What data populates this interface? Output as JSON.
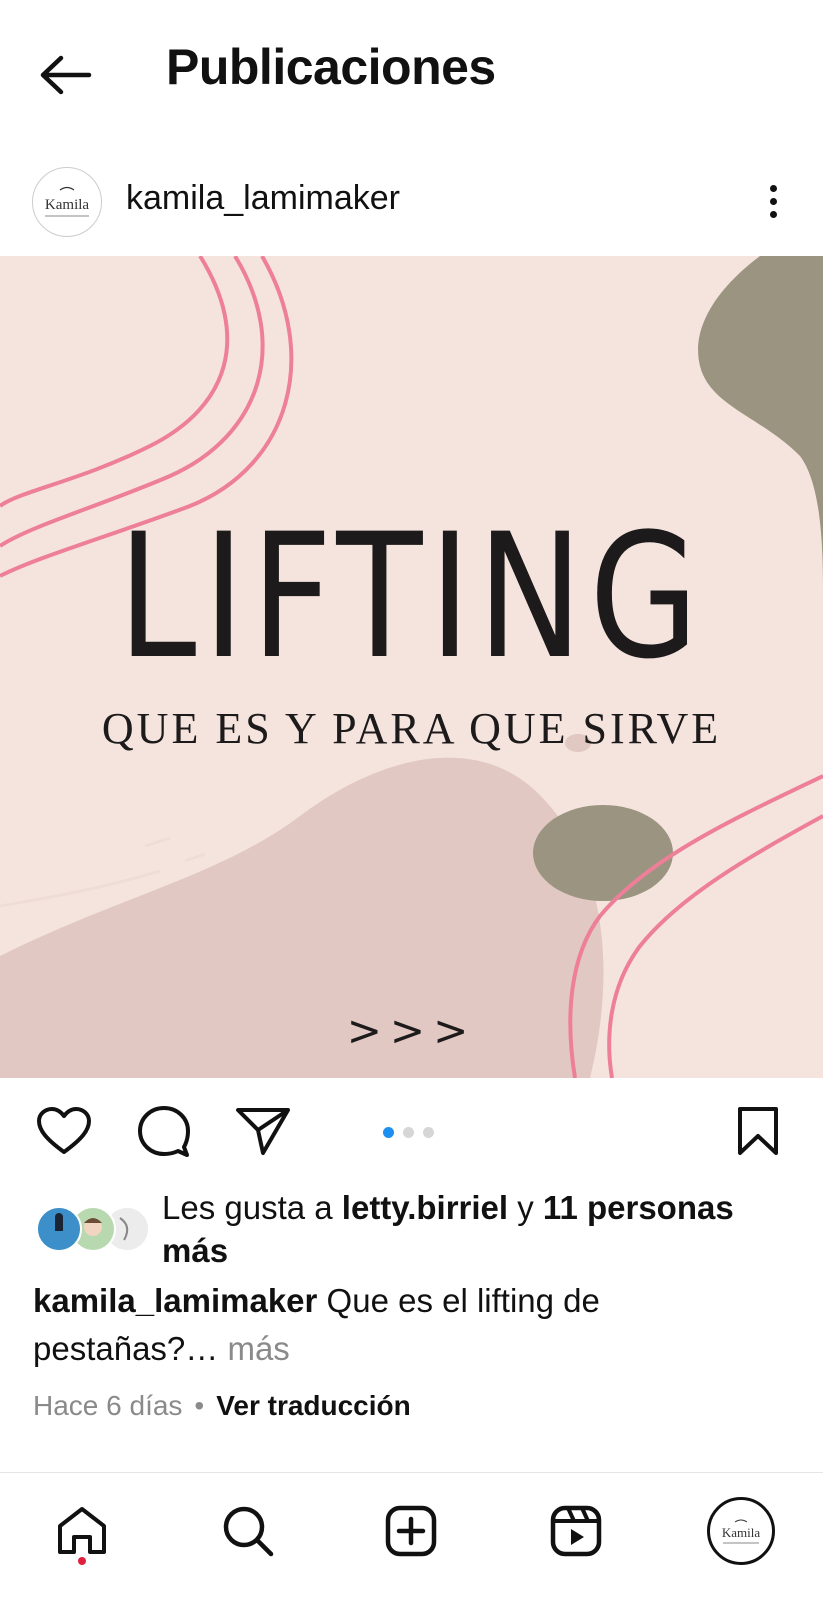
{
  "header": {
    "title": "Publicaciones"
  },
  "post": {
    "username": "kamila_lamimaker",
    "avatar_text": "Kamila",
    "image": {
      "title": "LIFTING",
      "subtitle": "QUE ES Y PARA QUE SIRVE",
      "arrows": ">>>"
    },
    "carousel": {
      "count": 3,
      "active": 1
    }
  },
  "likes": {
    "prefix": "Les gusta a ",
    "user": "letty.birriel",
    "middle": " y ",
    "others": "11 personas más"
  },
  "caption": {
    "username": "kamila_lamimaker",
    "text": " Que es el lifting de pestañas?…",
    "more": " más"
  },
  "meta": {
    "time": "Hace 6 días",
    "separator": "•",
    "translate": "Ver traducción"
  },
  "nav": {
    "profile_avatar_text": "Kamila"
  },
  "colors": {
    "image_bg": "#f5e4de",
    "pink_lines": "#ee7f98",
    "olive_blob": "#9a9480",
    "mauve_blob": "#e2c8c2",
    "carousel_active": "#1d8ff0",
    "notification_dot": "#e0203b"
  }
}
